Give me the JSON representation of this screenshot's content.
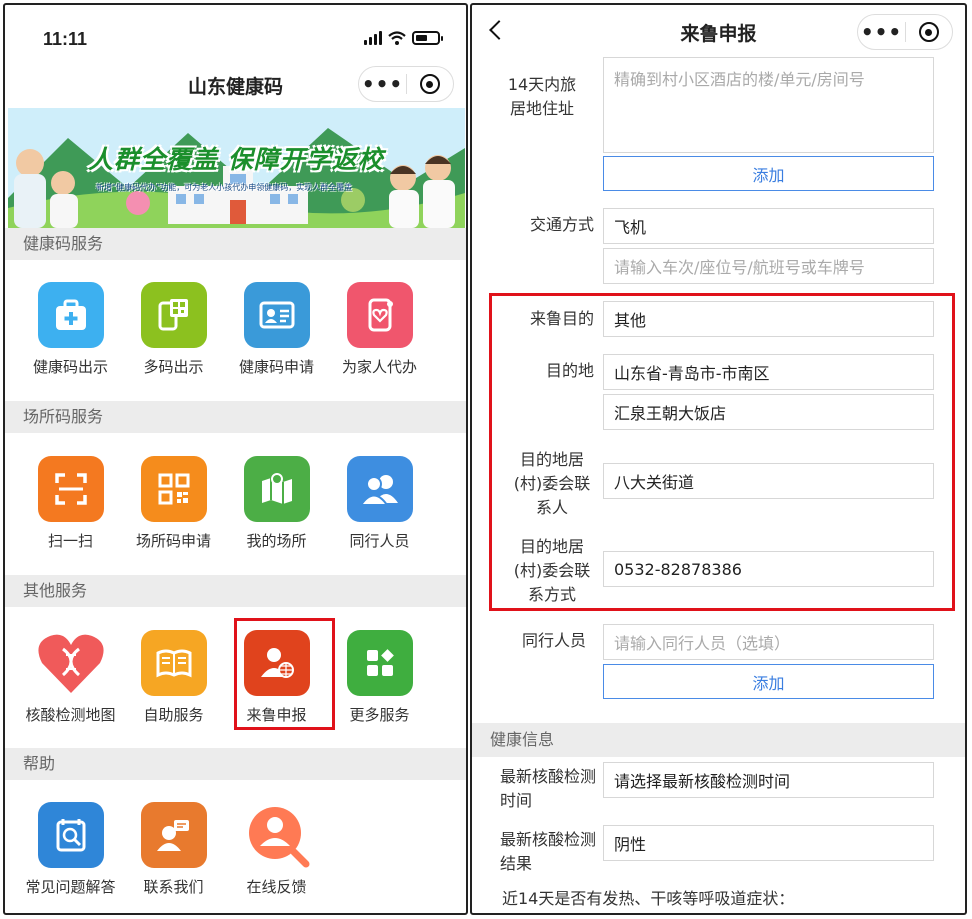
{
  "left": {
    "status_time": "11:11",
    "title": "山东健康码",
    "banner": {
      "headline": "人群全覆盖  保障开学返校",
      "subline": "新增“健康码代办”功能，可为老人小孩代办申领健康码，实现人群全覆盖"
    },
    "sections": [
      {
        "title": "健康码服务",
        "items": [
          {
            "label": "健康码出示",
            "icon": "medical-kit-icon",
            "color": "#3db0f0"
          },
          {
            "label": "多码出示",
            "icon": "multi-qr-phone-icon",
            "color": "#8cc11f"
          },
          {
            "label": "健康码申请",
            "icon": "id-card-icon",
            "color": "#3a9ad9"
          },
          {
            "label": "为家人代办",
            "icon": "phone-heart-icon",
            "color": "#f0566d"
          }
        ]
      },
      {
        "title": "场所码服务",
        "items": [
          {
            "label": "扫一扫",
            "icon": "scan-icon",
            "color": "#f47920"
          },
          {
            "label": "场所码申请",
            "icon": "qr-code-icon",
            "color": "#f58c1c"
          },
          {
            "label": "我的场所",
            "icon": "map-pin-icon",
            "color": "#4cae46"
          },
          {
            "label": "同行人员",
            "icon": "people-icon",
            "color": "#3e8ee0"
          }
        ]
      },
      {
        "title": "其他服务",
        "items": [
          {
            "label": "核酸检测地图",
            "icon": "dna-heart-icon",
            "color": "#f05a5a"
          },
          {
            "label": "自助服务",
            "icon": "self-service-book-icon",
            "color": "#f6a623"
          },
          {
            "label": "来鲁申报",
            "icon": "person-globe-icon",
            "color": "#e0431d"
          },
          {
            "label": "更多服务",
            "icon": "grid-more-icon",
            "color": "#3fae3f"
          }
        ]
      },
      {
        "title": "帮助",
        "items": [
          {
            "label": "常见问题解答",
            "icon": "faq-search-icon",
            "color": "#2f86d8"
          },
          {
            "label": "联系我们",
            "icon": "contact-chat-icon",
            "color": "#e87a2e"
          },
          {
            "label": "在线反馈",
            "icon": "feedback-person-icon",
            "color": "#ff7a54"
          }
        ]
      }
    ]
  },
  "right": {
    "title": "来鲁申报",
    "address_label": "14天内旅居地住址",
    "address_placeholder": "精确到村小区酒店的楼/单元/房间号",
    "add_label": "添加",
    "transport_label": "交通方式",
    "transport_value": "飞机",
    "transport_placeholder": "请输入车次/座位号/航班号或车牌号",
    "purpose_label": "来鲁目的",
    "purpose_value": "其他",
    "dest_label": "目的地",
    "dest_region": "山东省-青岛市-市南区",
    "dest_detail": "汇泉王朝大饭店",
    "contact_label": "目的地居(村)委会联系人",
    "contact_value": "八大关街道",
    "phone_label": "目的地居(村)委会联系方式",
    "phone_value": "0532-82878386",
    "companion_label": "同行人员",
    "companion_placeholder": "请输入同行人员（选填）",
    "add_label2": "添加",
    "health_section": "健康信息",
    "test_time_label": "最新核酸检测时间",
    "test_time_value": "请选择最新核酸检测时间",
    "test_result_label": "最新核酸检测结果",
    "test_result_value": "阴性",
    "symptom_question": "近14天是否有发热、干咳等呼吸道症状："
  }
}
